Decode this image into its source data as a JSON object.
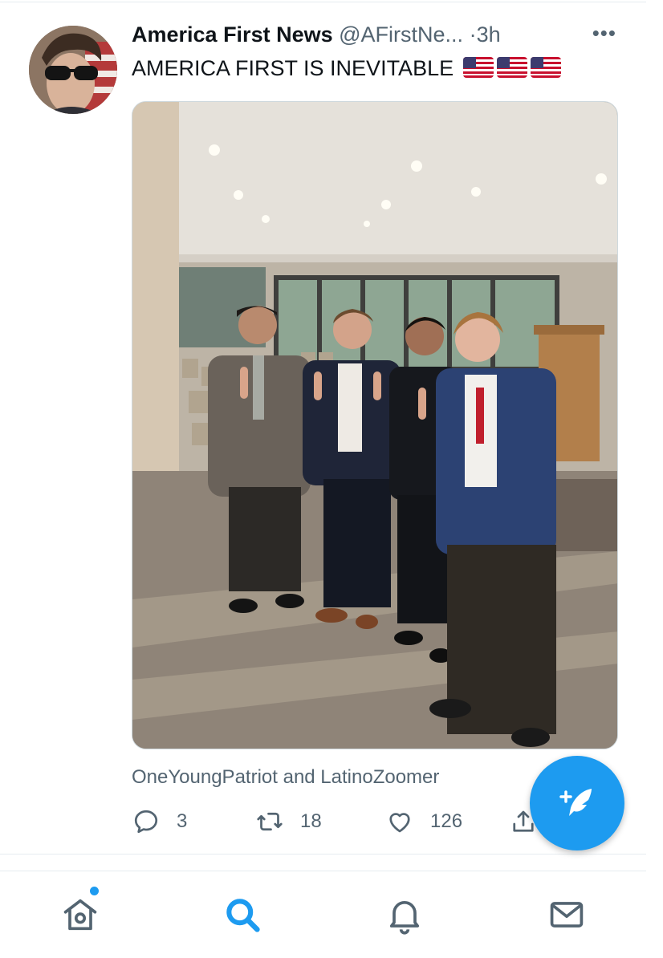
{
  "tweet": {
    "author_name": "America First News",
    "author_handle": "@AFirstNe...",
    "separator": "·",
    "time": "3h",
    "more_icon": "more-horizontal-icon",
    "text": "AMERICA FIRST IS INEVITABLE",
    "emojis": [
      "us-flag",
      "us-flag",
      "us-flag"
    ],
    "tagged_users": "OneYoungPatriot and LatinoZoomer"
  },
  "actions": {
    "reply": {
      "icon": "reply-icon",
      "count": "3"
    },
    "retweet": {
      "icon": "retweet-icon",
      "count": "18"
    },
    "like": {
      "icon": "heart-icon",
      "count": "126"
    },
    "share": {
      "icon": "share-icon"
    }
  },
  "compose": {
    "icon": "compose-tweet-icon"
  },
  "bottom_nav": [
    {
      "name": "home",
      "icon": "home-icon",
      "has_notification_dot": true
    },
    {
      "name": "search",
      "icon": "search-icon",
      "active": true
    },
    {
      "name": "notifications",
      "icon": "bell-icon"
    },
    {
      "name": "messages",
      "icon": "mail-icon"
    }
  ],
  "colors": {
    "accent": "#1d9bf0",
    "text_primary": "#0f1419",
    "text_secondary": "#536471",
    "divider": "#e6ecf0"
  }
}
